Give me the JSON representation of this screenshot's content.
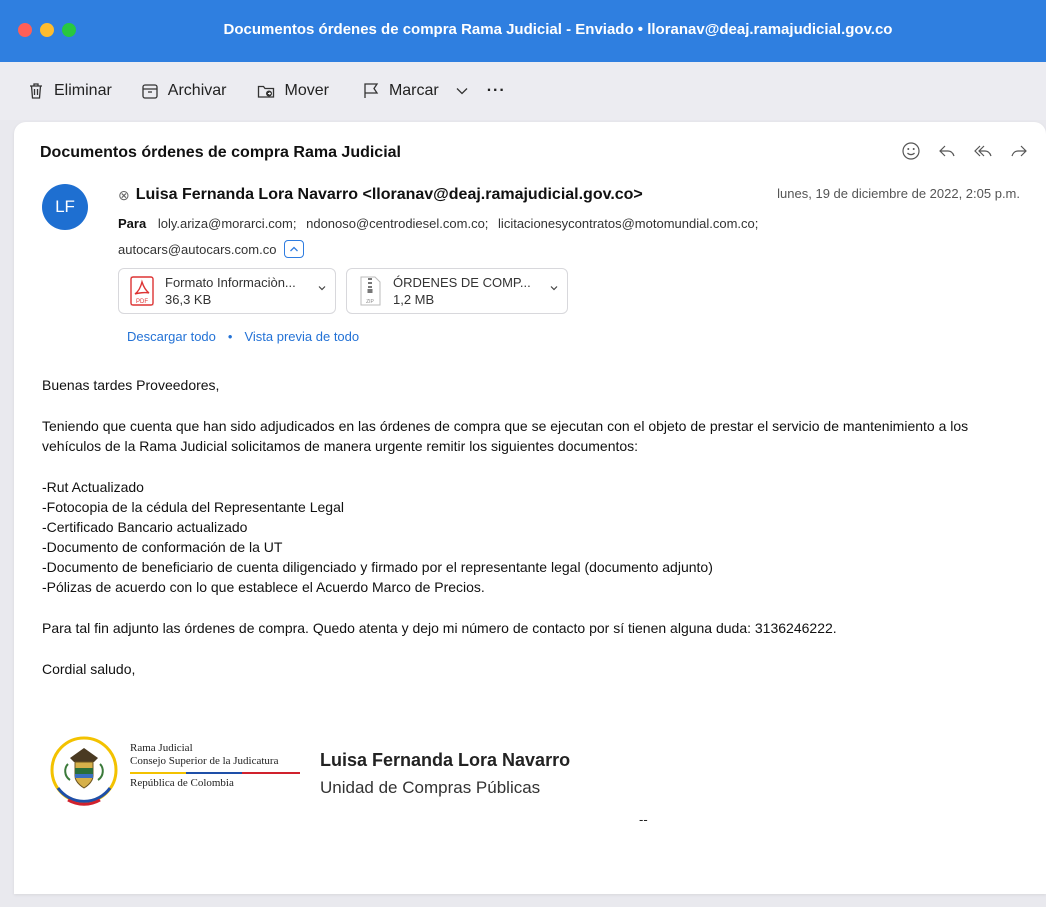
{
  "window": {
    "title": "Documentos órdenes de compra Rama Judicial - Enviado • lloranav@deaj.ramajudicial.gov.co",
    "lights": [
      "#fe5f57",
      "#febc2e",
      "#28c840"
    ]
  },
  "toolbar": {
    "delete_label": "Eliminar",
    "archive_label": "Archivar",
    "move_label": "Mover",
    "flag_label": "Marcar",
    "more_label": "···"
  },
  "message": {
    "subject": "Documentos órdenes de compra Rama Judicial",
    "avatar_initials": "LF",
    "avatar_color": "#1e6fd1",
    "sender": "Luisa Fernanda Lora Navarro <lloranav@deaj.ramajudicial.gov.co>",
    "date": "lunes, 19 de diciembre de 2022, 2:05 p.m.",
    "to_label": "Para",
    "recipients": [
      "loly.ariza@morarci.com;",
      "ndonoso@centrodiesel.com.co;",
      "licitacionesycontratos@motomundial.com.co;"
    ],
    "recipient_overflow": "autocars@autocars.com.co",
    "attachments": [
      {
        "name": "Formato Informaciòn...",
        "size": "36,3 KB",
        "icon": "pdf-icon"
      },
      {
        "name": "ÓRDENES DE COMP...",
        "size": "1,2 MB",
        "icon": "zip-icon"
      }
    ],
    "download_all": "Descargar todo",
    "link_separator": "•",
    "preview_all": "Vista previa de todo"
  },
  "body": {
    "greeting": "Buenas tardes Proveedores,",
    "paragraph1": "Teniendo que cuenta que han sido adjudicados en las órdenes de compra que se ejecutan con el objeto de prestar el servicio de mantenimiento a los vehículos de la Rama Judicial solicitamos de manera urgente remitir los siguientes documentos:",
    "items": [
      "-Rut Actualizado",
      "-Fotocopia de la cédula del Representante Legal",
      "-Certificado Bancario actualizado",
      "-Documento de conformación de la UT",
      "-Documento de beneficiario de cuenta diligenciado y firmado por el representante legal (documento adjunto)",
      "-Pólizas de acuerdo con lo que establece el Acuerdo Marco de Precios."
    ],
    "paragraph2": "Para tal fin adjunto las órdenes de compra. Quedo atenta y dejo mi número de contacto por sí tienen alguna duda: 3136246222.",
    "closing": "Cordial saludo,"
  },
  "signature": {
    "org_line1": "Rama Judicial",
    "org_line2": "Consejo Superior de la Judicatura",
    "org_line3": "República de Colombia",
    "name": "Luisa Fernanda Lora Navarro",
    "unit": "Unidad de Compras Públicas",
    "trailer": "--"
  }
}
